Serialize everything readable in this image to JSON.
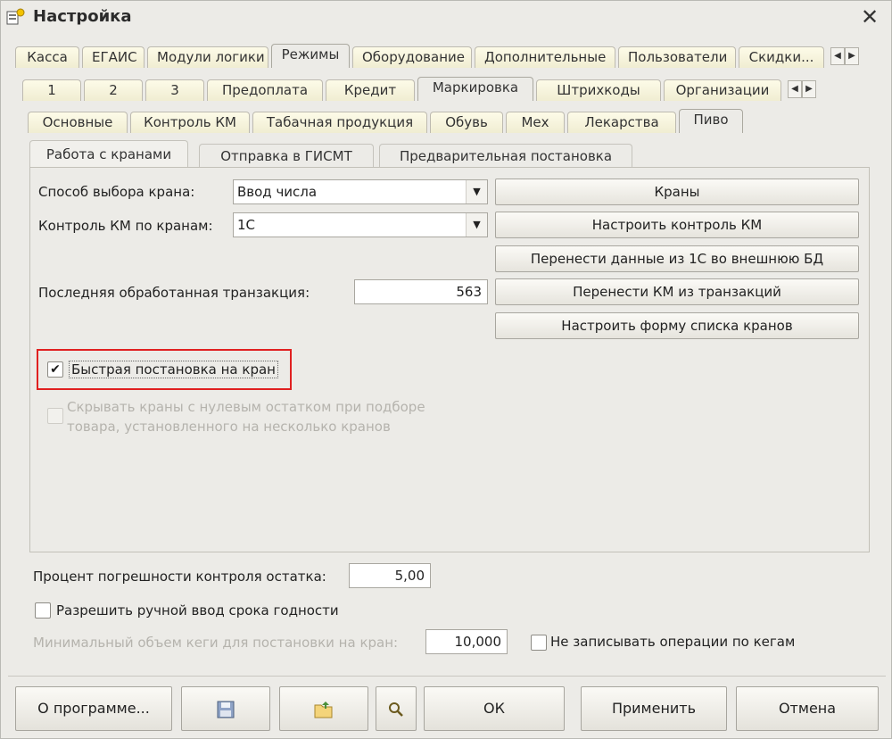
{
  "window": {
    "title": "Настройка"
  },
  "tabs_row1": [
    "Касса",
    "ЕГАИС",
    "Модули логики",
    "Режимы",
    "Оборудование",
    "Дополнительные",
    "Пользователи",
    "Скидки..."
  ],
  "tabs_row2": [
    "1",
    "2",
    "3",
    "Предоплата",
    "Кредит",
    "Маркировка",
    "Штрихкоды",
    "Организации"
  ],
  "tabs_row3": [
    "Основные",
    "Контроль КМ",
    "Табачная продукция",
    "Обувь",
    "Мех",
    "Лекарства",
    "Пиво"
  ],
  "tabs_row4": [
    "Работа с кранами",
    "Отправка в ГИСМТ",
    "Предварительная постановка"
  ],
  "form": {
    "tap_select_label": "Способ выбора крана:",
    "tap_select_value": "Ввод числа",
    "km_control_label": "Контроль КМ по кранам:",
    "km_control_value": "1С",
    "last_tx_label": "Последняя обработанная транзакция:",
    "last_tx_value": "563",
    "quick_tap_label": "Быстрая постановка на кран",
    "quick_tap_checked": true,
    "hide_taps_label_1": "Скрывать краны с нулевым остатком при подборе",
    "hide_taps_label_2": "товара, установленного на несколько кранов"
  },
  "buttons": {
    "taps": "Краны",
    "setup_km": "Настроить контроль КМ",
    "transfer_db": "Перенести данные из 1С во внешнюю БД",
    "transfer_km": "Перенести КМ из транзакций",
    "setup_list": "Настроить форму списка кранов"
  },
  "lower": {
    "error_pct_label": "Процент погрешности контроля остатка:",
    "error_pct_value": "5,00",
    "manual_expiry_label": "Разрешить ручной ввод срока годности",
    "min_keg_label": "Минимальный объем кеги для постановки на кран:",
    "min_keg_value": "10,000",
    "no_keg_ops_label": "Не записывать операции по кегам"
  },
  "footer": {
    "about": "О программе...",
    "ok": "ОК",
    "apply": "Применить",
    "cancel": "Отмена"
  },
  "icons": [
    "app-settings-icon",
    "close-icon",
    "save-icon",
    "open-folder-icon",
    "search-icon"
  ]
}
